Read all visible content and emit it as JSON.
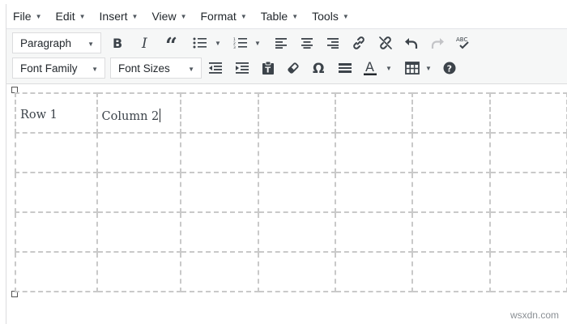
{
  "menu": [
    {
      "id": "file",
      "label": "File"
    },
    {
      "id": "edit",
      "label": "Edit"
    },
    {
      "id": "insert",
      "label": "Insert"
    },
    {
      "id": "view",
      "label": "View"
    },
    {
      "id": "format",
      "label": "Format"
    },
    {
      "id": "table",
      "label": "Table"
    },
    {
      "id": "tools",
      "label": "Tools"
    }
  ],
  "toolbar": {
    "paragraph_select": "Paragraph",
    "font_family_select": "Font Family",
    "font_sizes_select": "Font Sizes",
    "spellcheck_label": "ABC",
    "row1_icons": [
      "bold-icon",
      "italic-icon",
      "blockquote-icon",
      "bullet-list-icon",
      "numbered-list-icon",
      "align-left-icon",
      "align-center-icon",
      "align-right-icon",
      "link-icon",
      "unlink-icon",
      "undo-icon",
      "redo-icon",
      "spellcheck-icon"
    ],
    "row2_icons": [
      "outdent-icon",
      "indent-icon",
      "paste-text-icon",
      "clear-formatting-icon",
      "special-character-icon",
      "horizontal-line-icon",
      "text-color-icon",
      "table-icon",
      "help-icon"
    ],
    "text_color_accent": "#23282d"
  },
  "table": {
    "rows": [
      [
        "Row 1",
        "Column 2",
        "",
        "",
        "",
        "",
        ""
      ],
      [
        "",
        "",
        "",
        "",
        "",
        "",
        ""
      ],
      [
        "",
        "",
        "",
        "",
        "",
        "",
        ""
      ],
      [
        "",
        "",
        "",
        "",
        "",
        "",
        ""
      ],
      [
        "",
        "",
        "",
        "",
        "",
        "",
        ""
      ]
    ]
  },
  "watermark": "wsxdn.com"
}
